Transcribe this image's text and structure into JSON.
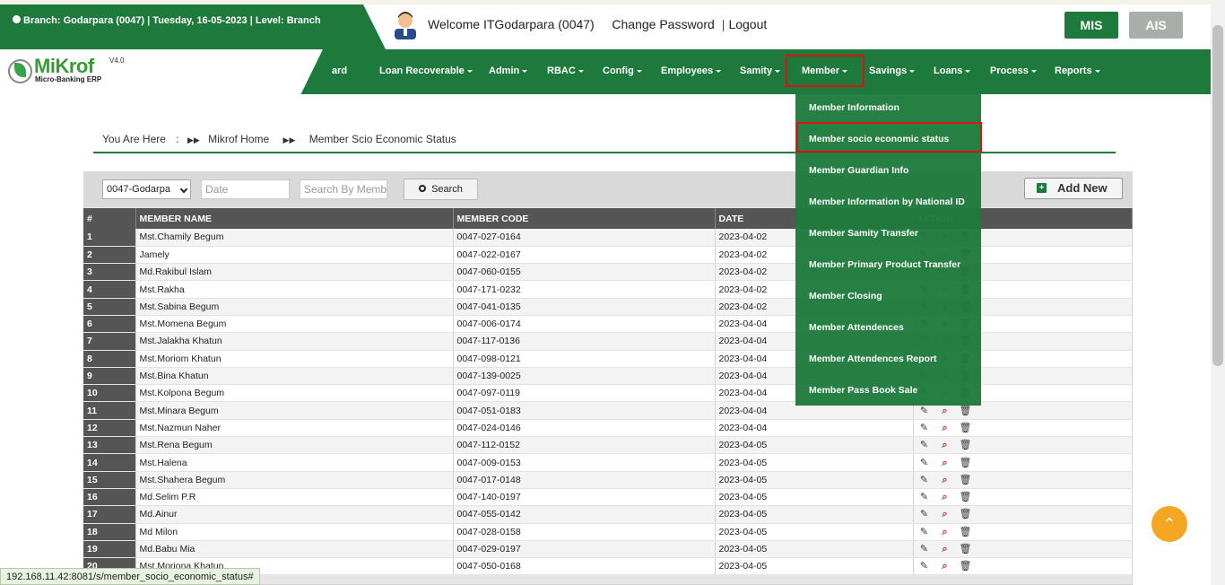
{
  "topbar": {
    "branch_info": "Branch: Godarpara (0047) | Tuesday, 16-05-2023 | Level: Branch",
    "welcome": "Welcome ITGodarpara (0047)",
    "change_password": "Change Password",
    "separator": "|",
    "logout": "Logout",
    "mis": "MIS",
    "ais": "AIS"
  },
  "logo": {
    "name": "MiKrof",
    "version": "V4.0",
    "subtitle": "Micro-Banking ERP"
  },
  "nav": {
    "fragment": "ard",
    "items": [
      "Loan Recoverable",
      "Admin",
      "RBAC",
      "Config",
      "Employees",
      "Samity",
      "Member",
      "Savings",
      "Loans",
      "Process",
      "Reports"
    ],
    "dropdown": [
      "Member Information",
      "Member socio economic status",
      "Member Guardian Info",
      "Member Information by National ID",
      "Member Samity Transfer",
      "Member Primary Product Transfer",
      "Member Closing",
      "Member Attendences",
      "Member Attendences Report",
      "Member Pass Book Sale"
    ]
  },
  "breadcrumb": {
    "you_are_here": "You Are Here",
    "colon": ":",
    "home": "Mikrof Home",
    "current": "Member Scio Economic Status"
  },
  "filters": {
    "branch_selected": "0047-Godarpa",
    "date_placeholder": "Date",
    "search_placeholder": "Search By Memb",
    "search_button": "Search",
    "add_new": "Add New"
  },
  "table": {
    "headers": [
      "#",
      "MEMBER NAME",
      "MEMBER CODE",
      "DATE",
      "ACTION"
    ],
    "rows": [
      [
        "1",
        "Mst.Chamily Begum",
        "0047-027-0164",
        "2023-04-02"
      ],
      [
        "2",
        "Jamely",
        "0047-022-0167",
        "2023-04-02"
      ],
      [
        "3",
        "Md.Rakibul Islam",
        "0047-060-0155",
        "2023-04-02"
      ],
      [
        "4",
        "Mst.Rakha",
        "0047-171-0232",
        "2023-04-02"
      ],
      [
        "5",
        "Mst.Sabina Begum",
        "0047-041-0135",
        "2023-04-02"
      ],
      [
        "6",
        "Mst.Momena Begum",
        "0047-006-0174",
        "2023-04-04"
      ],
      [
        "7",
        "Mst.Jalakha Khatun",
        "0047-117-0136",
        "2023-04-04"
      ],
      [
        "8",
        "Mst.Moriom Khatun",
        "0047-098-0121",
        "2023-04-04"
      ],
      [
        "9",
        "Mst.Bina Khatun",
        "0047-139-0025",
        "2023-04-04"
      ],
      [
        "10",
        "Mst.Kolpona Begum",
        "0047-097-0119",
        "2023-04-04"
      ],
      [
        "11",
        "Mst.Minara Begum",
        "0047-051-0183",
        "2023-04-04"
      ],
      [
        "12",
        "Mst.Nazmun Naher",
        "0047-024-0146",
        "2023-04-04"
      ],
      [
        "13",
        "Mst.Rena Begum",
        "0047-112-0152",
        "2023-04-05"
      ],
      [
        "14",
        "Mst.Halena",
        "0047-009-0153",
        "2023-04-05"
      ],
      [
        "15",
        "Mst.Shahera Begum",
        "0047-017-0148",
        "2023-04-05"
      ],
      [
        "16",
        "Md.Selim P.R",
        "0047-140-0197",
        "2023-04-05"
      ],
      [
        "17",
        "Md.Ainur",
        "0047-055-0142",
        "2023-04-05"
      ],
      [
        "18",
        "Md Milon",
        "0047-028-0158",
        "2023-04-05"
      ],
      [
        "19",
        "Md.Babu Mia",
        "0047-029-0197",
        "2023-04-05"
      ],
      [
        "20",
        "Mst.Moriona Khatun",
        "0047-050-0168",
        "2023-04-05"
      ]
    ]
  },
  "status_url": "192.168.11.42:8081/s/member_socio_economic_status#",
  "colors": {
    "brand_green": "#1e7a3c",
    "highlight_red": "#dd1111",
    "scroll_top": "#f5a623"
  },
  "icons": {
    "edit": "edit-icon",
    "view": "search-icon",
    "delete": "trash-icon",
    "scroll_top": "chevron-up-icon"
  }
}
